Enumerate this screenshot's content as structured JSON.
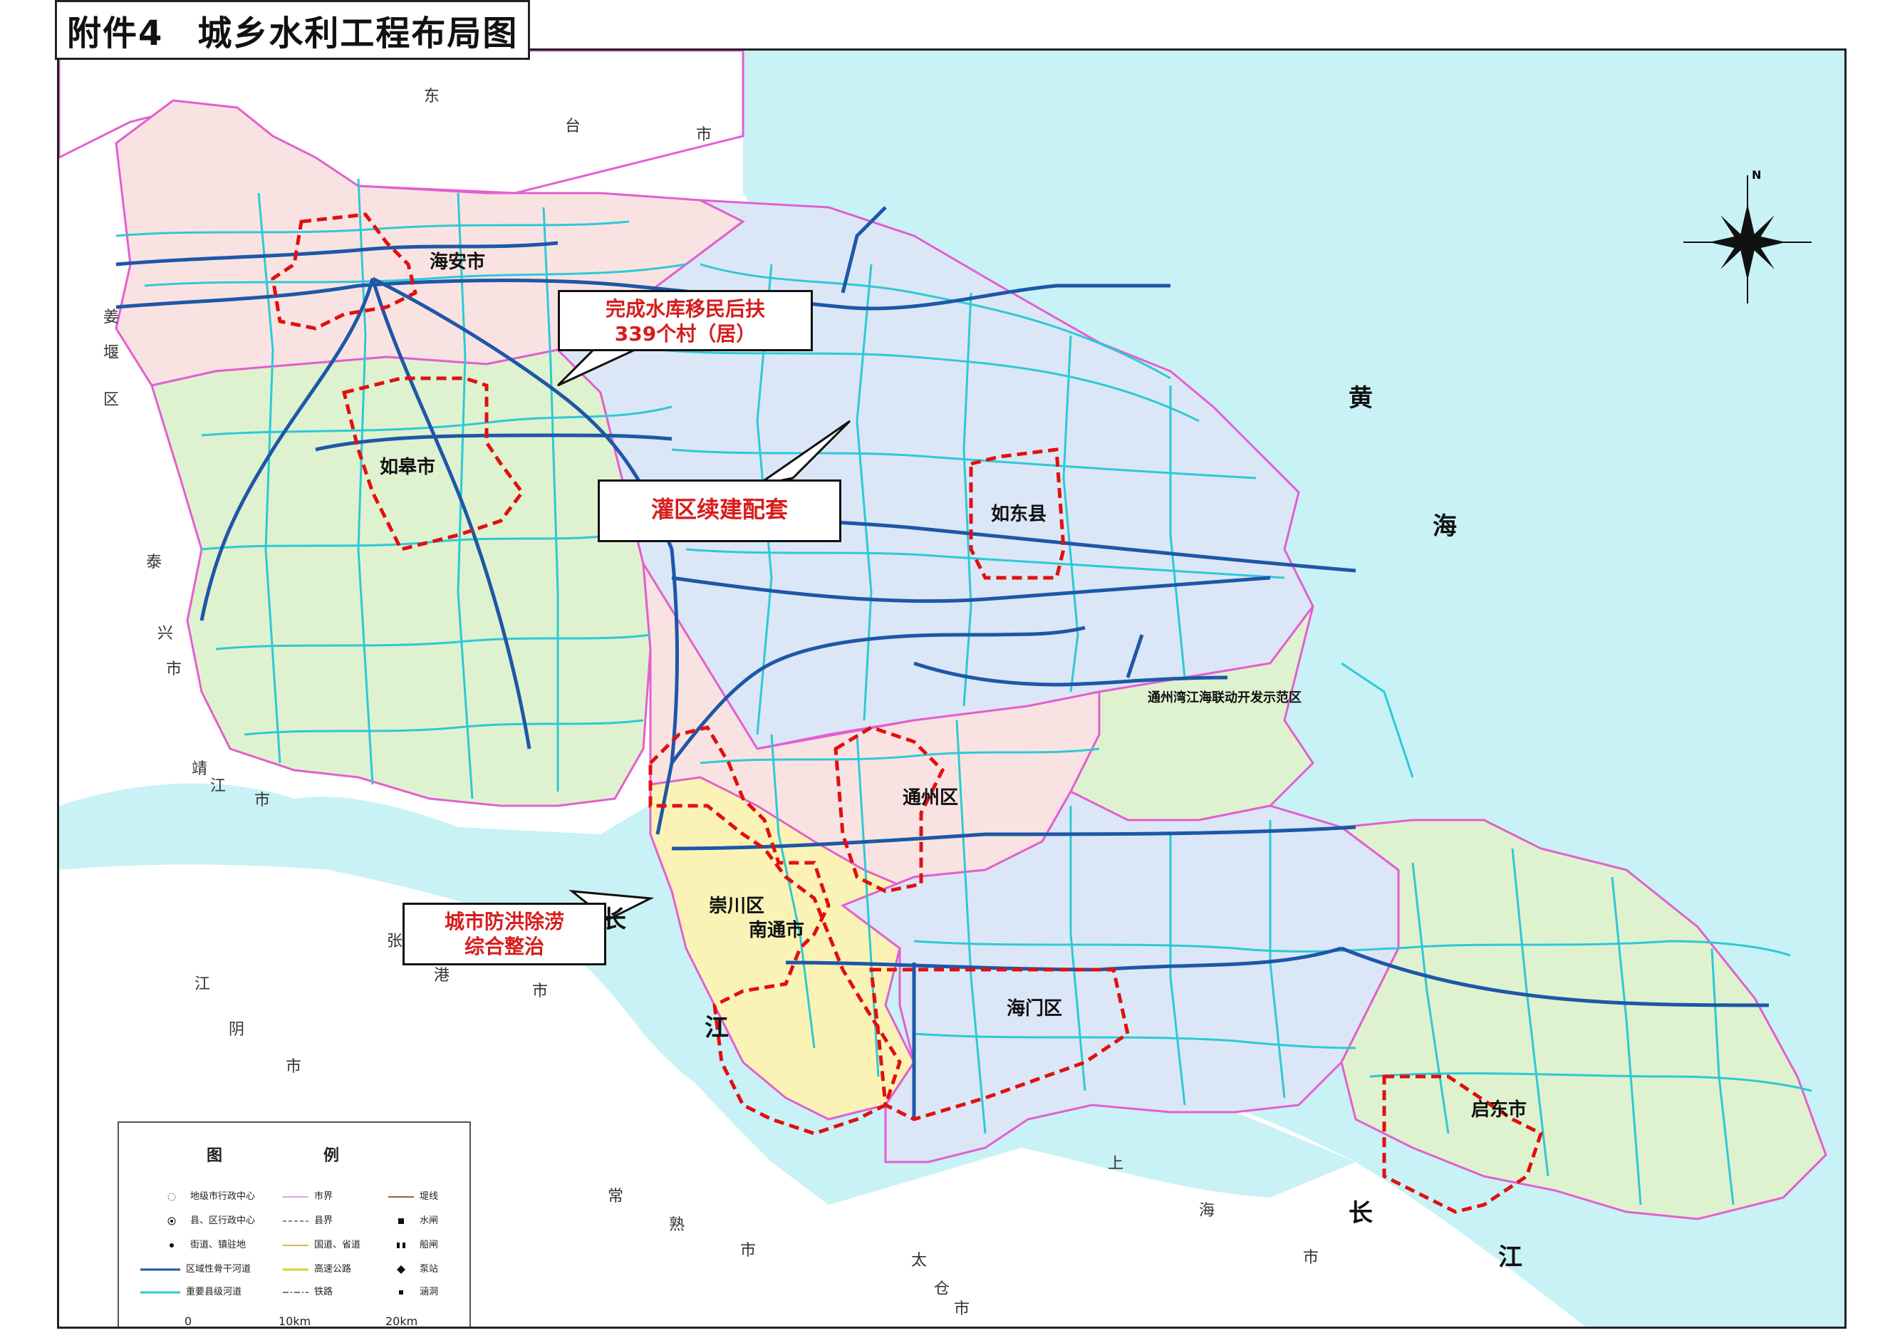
{
  "title": "附件4　城乡水利工程布局图",
  "title_parts": {
    "prefix": "附件4",
    "main": "城乡水利工程布局图"
  },
  "callouts": [
    {
      "id": "reservoir",
      "line1": "完成水库移民后扶",
      "line2": "339个村（居）",
      "color": "red"
    },
    {
      "id": "irrigation",
      "line1": "灌区续建配套",
      "line2": "",
      "color": "red"
    },
    {
      "id": "flood",
      "line1": "城市防洪除涝",
      "line2": "综合整治",
      "color": "red"
    }
  ],
  "cities": {
    "haian": "海安市",
    "rugao": "如皋市",
    "rudong": "如东县",
    "tongzhou": "通州区",
    "chongchuan": "崇川区",
    "nantong": "南通市",
    "haimen": "海门区",
    "qidong": "启东市",
    "demo_zone": "通州湾江海联动开发示范区"
  },
  "sea_labels": [
    "黄",
    "海",
    "长",
    "江",
    "长",
    "江"
  ],
  "outside_labels": {
    "dongtai": [
      "东",
      "台",
      "市"
    ],
    "jiangyan": [
      "姜",
      "堰",
      "区"
    ],
    "taixing": [
      "泰",
      "兴",
      "市"
    ],
    "jingjiang": [
      "靖",
      "江",
      "市"
    ],
    "zhangjiagang": [
      "张",
      "港",
      "市"
    ],
    "jiangyin": [
      "江",
      "阴",
      "市"
    ],
    "changshu": [
      "常",
      "熟",
      "市"
    ],
    "taicang": [
      "太",
      "仓",
      "市"
    ],
    "shanghai": [
      "上",
      "海",
      "市"
    ]
  },
  "compass": {
    "label": "N"
  },
  "legend": {
    "heading": "图　例",
    "items": [
      {
        "icon": "town-center-icon",
        "label": "地级市行政中心"
      },
      {
        "icon": "county-center-icon",
        "label": "县、区行政中心"
      },
      {
        "icon": "street-icon",
        "label": "街道、镇驻地"
      },
      {
        "icon": "main-river-icon",
        "label": "区域性骨干河道"
      },
      {
        "icon": "county-river-icon",
        "label": "重要县级河道"
      },
      {
        "icon": "city-border-icon",
        "label": "市界"
      },
      {
        "icon": "county-border-icon",
        "label": "县界"
      },
      {
        "icon": "national-road-icon",
        "label": "国道、省道"
      },
      {
        "icon": "highway-icon",
        "label": "高速公路"
      },
      {
        "icon": "railway-icon",
        "label": "铁路"
      },
      {
        "icon": "dike-icon",
        "label": "堤线"
      },
      {
        "icon": "sluice-icon",
        "label": "水闸"
      },
      {
        "icon": "ship-lock-icon",
        "label": "船闸"
      },
      {
        "icon": "pump-icon",
        "label": "泵站"
      },
      {
        "icon": "culvert-icon",
        "label": "涵洞"
      }
    ]
  },
  "scale": {
    "zero": "0",
    "mid": "10km",
    "end": "20km"
  },
  "colors": {
    "sea": "#c8f2f6",
    "haian": "#f9e3e2",
    "rugao": "#dff2cf",
    "rudong": "#dbe7f6",
    "tongzhou": "#f9e3e2",
    "chongchuan": "#fbf3b5",
    "haimen": "#dbe7f6",
    "qidong": "#dff2cf",
    "main_river": "#1e57a8",
    "county_river": "#2ec9d6",
    "border_pink": "#e35fd0",
    "project_red": "#e01010"
  }
}
